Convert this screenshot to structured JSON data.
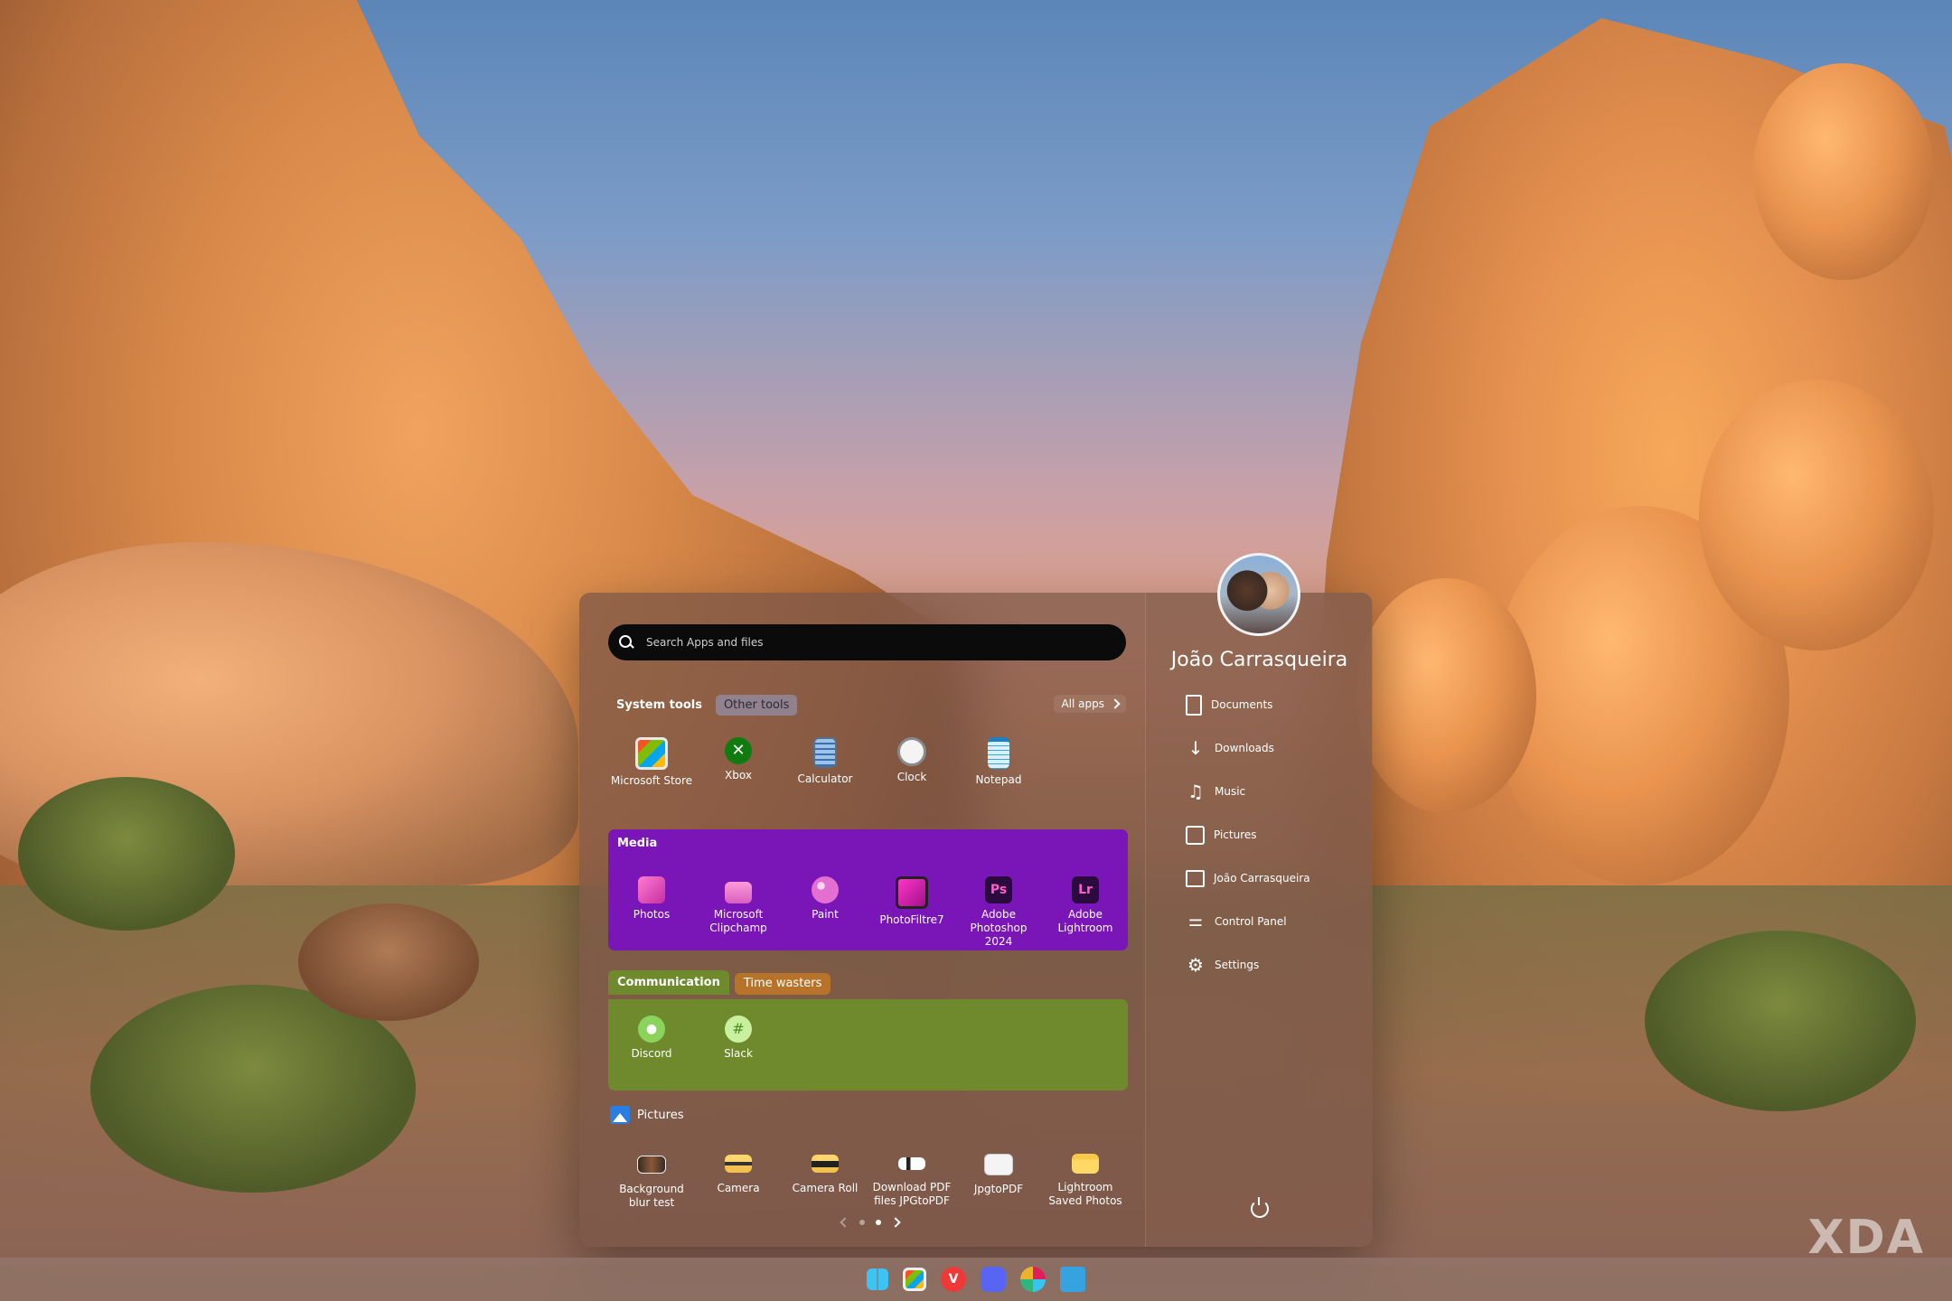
{
  "search": {
    "placeholder": "Search Apps and files"
  },
  "top_tabs": {
    "active": "System tools",
    "other": "Other tools",
    "all_apps": "All apps"
  },
  "system_tools": [
    {
      "label": "Microsoft Store",
      "icon": "store-icon"
    },
    {
      "label": "Xbox",
      "icon": "xbox-icon"
    },
    {
      "label": "Calculator",
      "icon": "calculator-icon"
    },
    {
      "label": "Clock",
      "icon": "clock-icon"
    },
    {
      "label": "Notepad",
      "icon": "notepad-icon"
    }
  ],
  "media": {
    "title": "Media",
    "color": "#7a16b8",
    "apps": [
      {
        "label": "Photos",
        "icon": "photos-icon"
      },
      {
        "label": "Microsoft Clipchamp",
        "icon": "clipchamp-icon"
      },
      {
        "label": "Paint",
        "icon": "paint-icon"
      },
      {
        "label": "PhotoFiltre7",
        "icon": "photofiltre-icon"
      },
      {
        "label": "Adobe Photoshop 2024",
        "icon": "photoshop-icon"
      },
      {
        "label": "Adobe Lightroom",
        "icon": "lightroom-icon"
      }
    ]
  },
  "communication": {
    "tab_active": "Communication",
    "tab_other": "Time wasters",
    "color": "#6e8a2c",
    "apps": [
      {
        "label": "Discord",
        "icon": "discord-icon"
      },
      {
        "label": "Slack",
        "icon": "slack-icon"
      }
    ]
  },
  "pictures": {
    "title": "Pictures",
    "items": [
      {
        "label": "Background blur test",
        "icon": "image-file-icon"
      },
      {
        "label": "Camera",
        "icon": "folder-icon"
      },
      {
        "label": "Camera Roll",
        "icon": "folder-icon"
      },
      {
        "label": "Download PDF files JPGtoPDF",
        "icon": "image-file-icon"
      },
      {
        "label": "JpgtoPDF",
        "icon": "image-file-icon"
      },
      {
        "label": "Lightroom Saved Photos",
        "icon": "folder-icon"
      }
    ]
  },
  "user": {
    "name": "João Carrasqueira"
  },
  "places": [
    {
      "label": "Documents",
      "icon": "document-icon"
    },
    {
      "label": "Downloads",
      "icon": "download-icon"
    },
    {
      "label": "Music",
      "icon": "music-icon"
    },
    {
      "label": "Pictures",
      "icon": "picture-icon"
    },
    {
      "label": "João Carrasqueira",
      "icon": "user-folder-icon"
    },
    {
      "label": "Control Panel",
      "icon": "control-panel-icon"
    },
    {
      "label": "Settings",
      "icon": "gear-icon"
    }
  ],
  "taskbar": [
    "windows-start-icon",
    "store-icon",
    "vivaldi-icon",
    "discord-icon",
    "slack-icon",
    "app-icon"
  ],
  "watermark": "XDA"
}
